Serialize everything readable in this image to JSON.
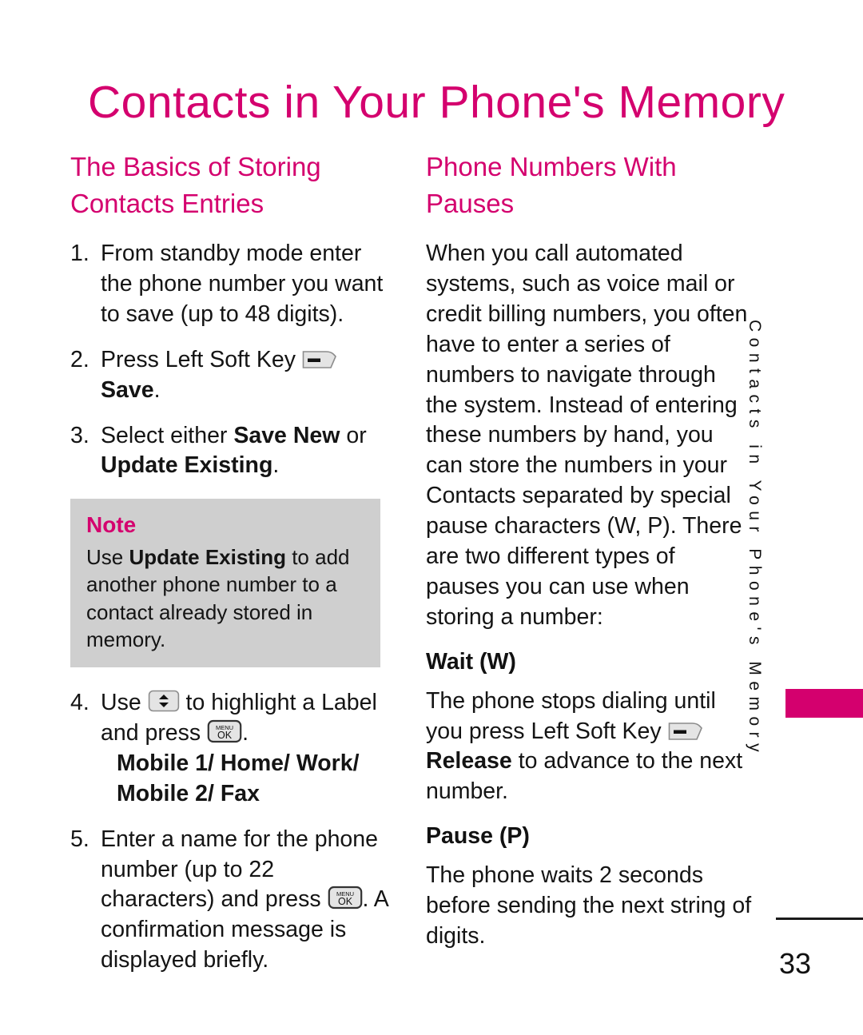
{
  "document": {
    "title": "Contacts in Your Phone's Memory",
    "page_number": "33",
    "side_tab_label": "Contacts in Your Phone's Memory",
    "accent_color": "#D4006E",
    "note_background_color": "#CFCFCF",
    "text_color": "#141414"
  },
  "left_column": {
    "heading": "The Basics of Storing Contacts Entries",
    "steps": [
      {
        "num": "1.",
        "text": "From standby mode enter the phone number you want to save (up to 48 digits)."
      },
      {
        "num": "2.",
        "text_before": "Press Left Soft Key",
        "icon": "left-soft-key-icon",
        "text_after_bold": "Save",
        "text_after": "."
      },
      {
        "num": "3.",
        "text_before": "Select either",
        "bold_1": "Save New",
        "text_middle": "or",
        "bold_2": "Update Existing",
        "text_after": "."
      },
      {
        "num": "4.",
        "text_before": "Use",
        "icon": "up-down-navigation-key-icon",
        "text_middle": "to highlight a Label and press",
        "icon_2": "menu-ok-key-icon",
        "text_after": ".",
        "labels_line_1": "Mobile 1/ Home/ Work/",
        "labels_line_2": "Mobile 2/ Fax"
      },
      {
        "num": "5.",
        "text_before": "Enter a name for the phone number (up to 22 characters) and press",
        "icon": "menu-ok-key-icon",
        "text_after": ". A confirmation message is displayed briefly."
      }
    ],
    "note": {
      "title": "Note",
      "text_before": "Use",
      "bold": "Update Existing",
      "text_after": "to add another phone number to a contact already stored in memory."
    }
  },
  "right_column": {
    "heading": "Phone Numbers With Pauses",
    "intro": "When you call automated systems, such as voice mail or credit billing numbers, you often have to enter a series of numbers to navigate through the system. Instead of entering these numbers by hand, you can store the numbers in your Contacts separated by special pause characters (W, P). There are two different types of pauses you can use when storing a number:",
    "sections": [
      {
        "heading": "Wait (W)",
        "text_before": "The phone stops dialing until you press Left Soft Key",
        "icon": "left-soft-key-icon",
        "bold": "Release",
        "text_after": "to advance to the next number."
      },
      {
        "heading": "Pause (P)",
        "text": "The phone waits 2 seconds before sending the next string of digits."
      }
    ]
  },
  "icons": {
    "menu_ok_top_label": "MENU",
    "menu_ok_bottom_label": "OK"
  }
}
